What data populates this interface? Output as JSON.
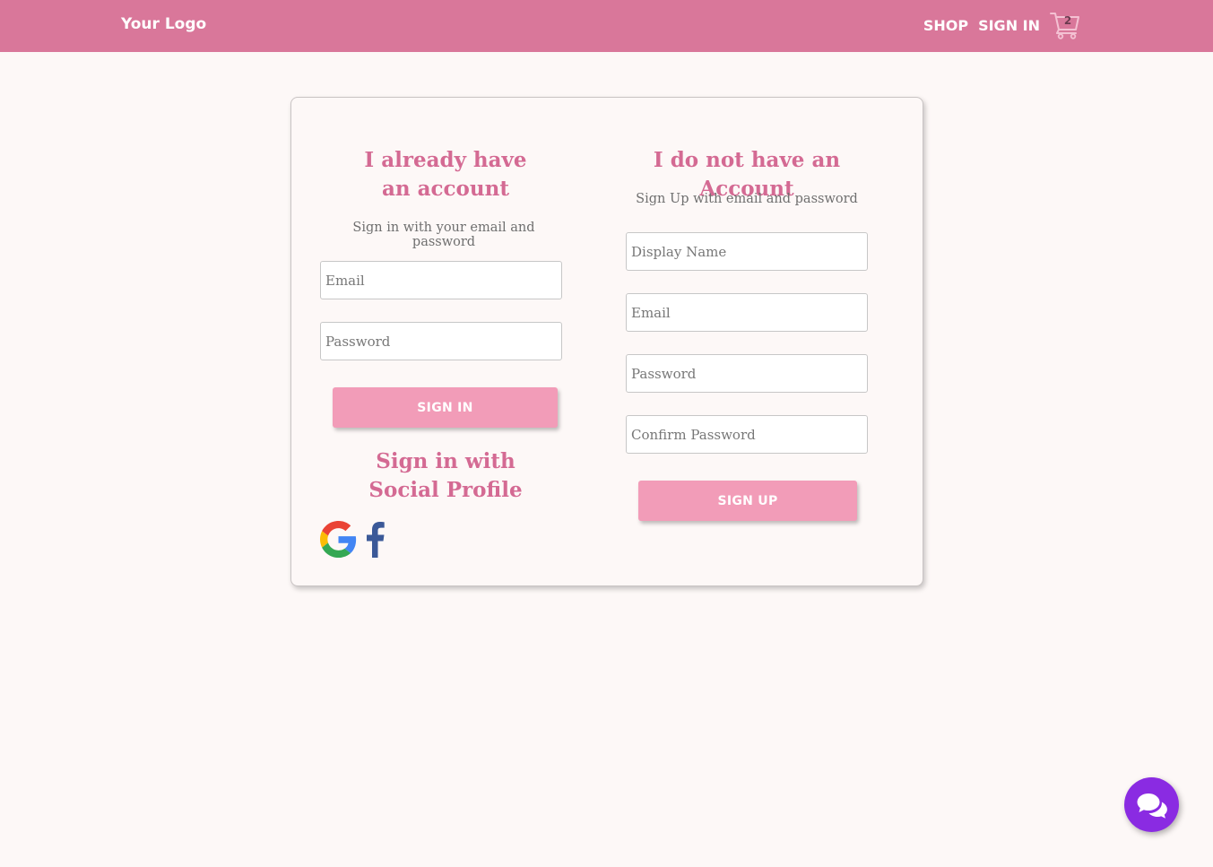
{
  "header": {
    "logo": "Your Logo",
    "nav": {
      "shop": "SHOP",
      "sign_in": "SIGN IN"
    },
    "cart": {
      "icon": "cart-icon",
      "count": "2"
    },
    "background_color": "#d9779a"
  },
  "signin_section": {
    "title": "I already have an account",
    "subtitle": "Sign in with your email and password",
    "email_placeholder": "Email",
    "password_placeholder": "Password",
    "submit_label": "SIGN IN",
    "social_title": "Sign in with Social Profile",
    "social_providers": [
      "google-icon",
      "facebook-icon"
    ]
  },
  "signup_section": {
    "title": "I do not have an Account",
    "subtitle": "Sign Up with email and password",
    "display_name_placeholder": "Display Name",
    "email_placeholder": "Email",
    "password_placeholder": "Password",
    "confirm_password_placeholder": "Confirm Password",
    "submit_label": "SIGN UP"
  },
  "chat_widget": {
    "icon": "chat-bubbles-icon",
    "color": "#8a2be2"
  },
  "colors": {
    "accent": "#d46a93",
    "button": "#f29cb8",
    "page_bg": "#fdf8f7"
  }
}
